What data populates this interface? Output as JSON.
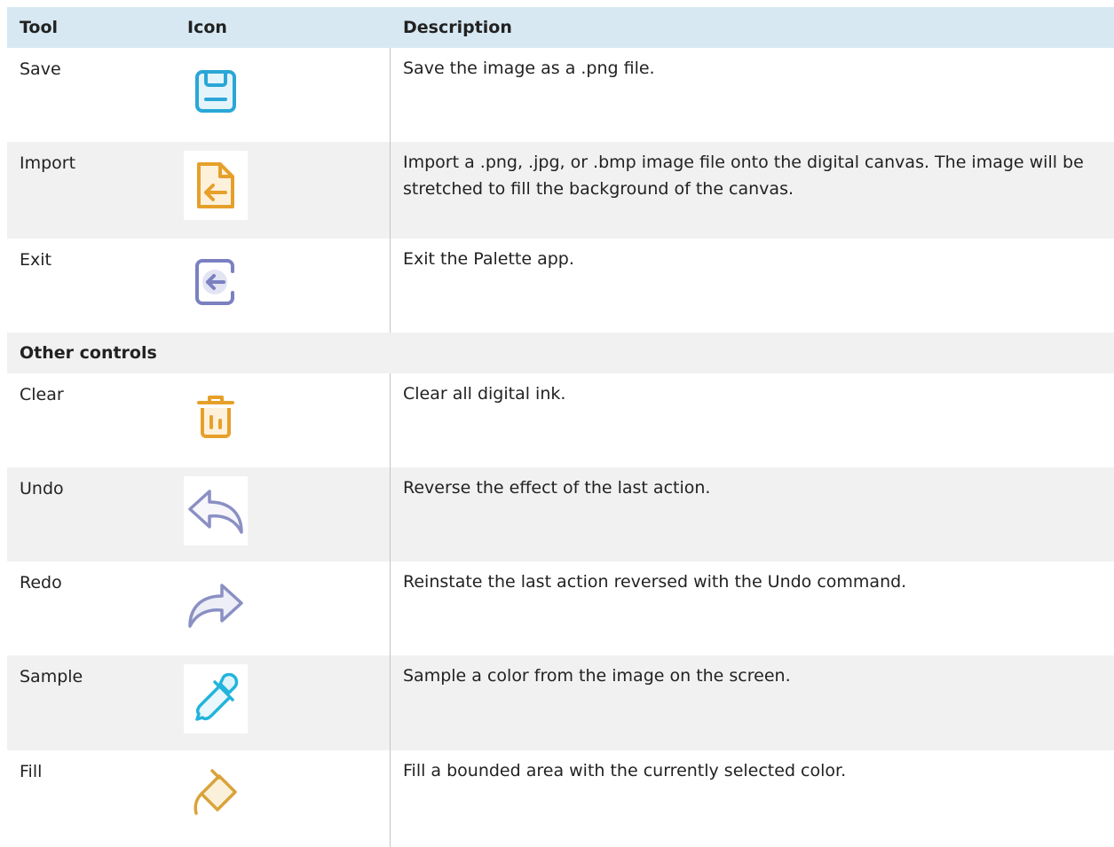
{
  "header": {
    "tool": "Tool",
    "icon": "Icon",
    "description": "Description"
  },
  "section_label": "Other controls",
  "rows_top": [
    {
      "tool": "Save",
      "icon": "save-icon",
      "description": "Save the image as a .png file."
    },
    {
      "tool": "Import",
      "icon": "import-icon",
      "description": "Import a .png, .jpg, or .bmp image file onto the digital canvas. The image will be stretched to fill the background of the canvas."
    },
    {
      "tool": "Exit",
      "icon": "exit-icon",
      "description": "Exit the Palette app."
    }
  ],
  "rows_other": [
    {
      "tool": "Clear",
      "icon": "trash-icon",
      "description": "Clear all digital ink."
    },
    {
      "tool": "Undo",
      "icon": "undo-icon",
      "description": "Reverse the effect of the last action."
    },
    {
      "tool": "Redo",
      "icon": "redo-icon",
      "description": "Reinstate the last action reversed with the Undo command."
    },
    {
      "tool": "Sample",
      "icon": "eyedropper-icon",
      "description": "Sample a color from the image on the screen."
    },
    {
      "tool": "Fill",
      "icon": "fill-bucket-icon",
      "description": "Fill a bounded area with the currently selected color."
    }
  ],
  "colors": {
    "header_bg": "#d7e8f3",
    "alt_row_bg": "#f1f1f1",
    "save_blue": "#2aa7d6",
    "import_orange": "#e6a02a",
    "exit_purple": "#7a80c0",
    "clear_orange": "#e6a02a",
    "undo_purple": "#8a8fc4",
    "sample_cyan": "#22b4dc",
    "fill_orange": "#d9a33a"
  }
}
